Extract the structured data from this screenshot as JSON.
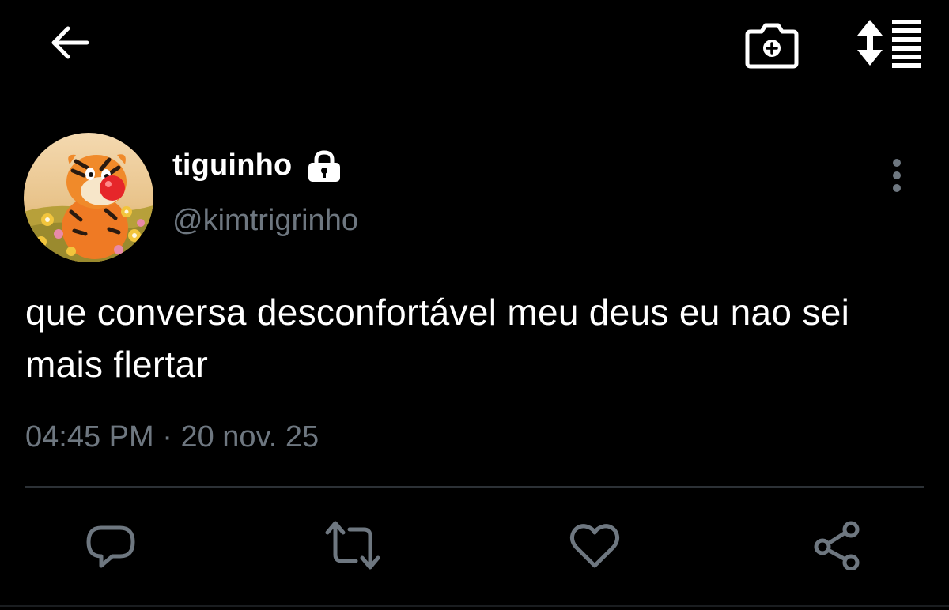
{
  "header": {
    "back_icon": "arrow-left-icon",
    "camera_icon": "camera-plus-icon",
    "sort_icon": "sort-list-icon"
  },
  "tweet": {
    "display_name": "tiguinho",
    "handle": "@kimtrigrinho",
    "protected_icon": "lock-icon",
    "more_icon": "vertical-dots-icon",
    "text": "que conversa desconfortável meu deus eu nao sei mais flertar",
    "time": "04:45 PM",
    "separator": " · ",
    "date": "20 nov. 25"
  },
  "actions": {
    "reply_icon": "comment-icon",
    "retweet_icon": "retweet-icon",
    "like_icon": "heart-icon",
    "share_icon": "share-icon"
  },
  "colors": {
    "background": "#000000",
    "primary_text": "#ffffff",
    "secondary_text": "#6e7780",
    "icon_gray": "#6e7780",
    "divider": "#2c3136"
  }
}
